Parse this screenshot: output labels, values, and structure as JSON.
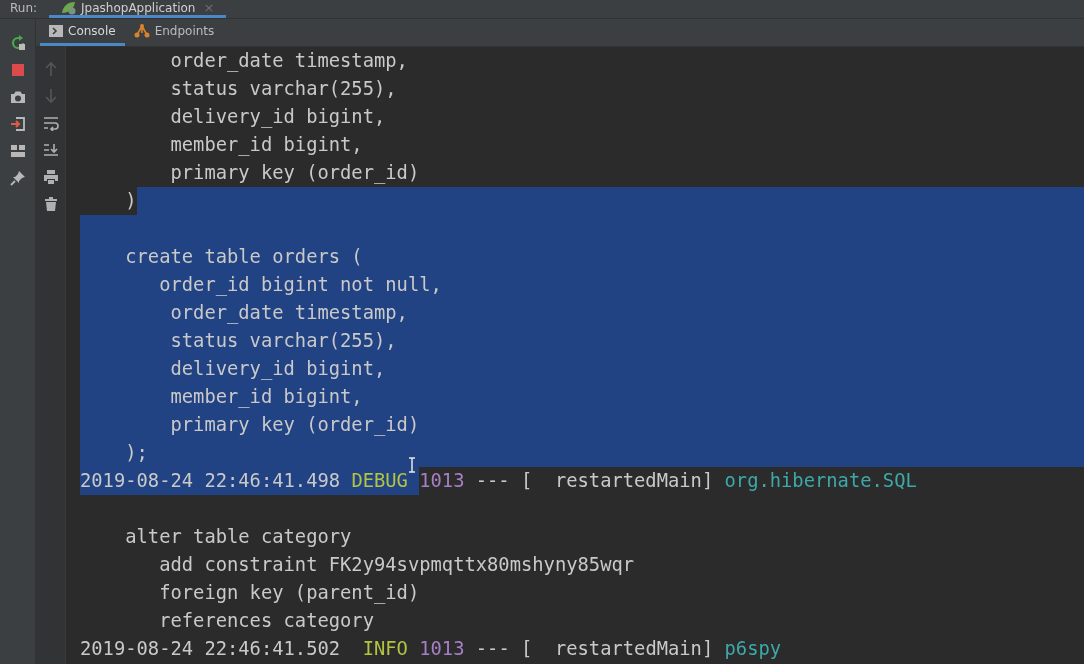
{
  "run_bar": {
    "label": "Run:",
    "tabs": [
      {
        "title": "JpashopApplication",
        "selected": true,
        "close": "×"
      }
    ]
  },
  "console_tabs": [
    {
      "label": "Console",
      "kind": "console",
      "selected": true
    },
    {
      "label": "Endpoints",
      "kind": "endpoints",
      "selected": false
    }
  ],
  "side_toolbar": [
    {
      "kind": "rerun"
    },
    {
      "kind": "stop"
    },
    {
      "kind": "camera"
    },
    {
      "kind": "exit"
    },
    {
      "kind": "layout"
    },
    {
      "kind": "pin"
    }
  ],
  "gutter_toolbar": [
    {
      "kind": "up",
      "disabled": true
    },
    {
      "kind": "down",
      "disabled": true
    },
    {
      "kind": "wrap",
      "disabled": false
    },
    {
      "kind": "scroll-end",
      "disabled": false
    },
    {
      "kind": "print",
      "disabled": false
    },
    {
      "kind": "trash",
      "disabled": false
    }
  ],
  "console_lines": [
    {
      "segments": [
        {
          "text": "        order_date timestamp,",
          "kind": "plain",
          "selected": false
        }
      ],
      "eol_selected": false
    },
    {
      "segments": [
        {
          "text": "        status varchar(255),",
          "kind": "plain",
          "selected": false
        }
      ],
      "eol_selected": false
    },
    {
      "segments": [
        {
          "text": "        delivery_id bigint,",
          "kind": "plain",
          "selected": false
        }
      ],
      "eol_selected": false
    },
    {
      "segments": [
        {
          "text": "        member_id bigint,",
          "kind": "plain",
          "selected": false
        }
      ],
      "eol_selected": false
    },
    {
      "segments": [
        {
          "text": "        primary key (order_id)",
          "kind": "plain",
          "selected": false
        }
      ],
      "eol_selected": false
    },
    {
      "segments": [
        {
          "text": "    )",
          "kind": "plain",
          "selected": false
        }
      ],
      "eol_selected": true
    },
    {
      "eol_selected": true
    },
    {
      "segments": [
        {
          "text": "    create table orders (",
          "kind": "plain",
          "selected": true
        }
      ],
      "eol_selected": true
    },
    {
      "segments": [
        {
          "text": "       order_id bigint not null,",
          "kind": "plain",
          "selected": true
        }
      ],
      "eol_selected": true
    },
    {
      "segments": [
        {
          "text": "        order_date timestamp,",
          "kind": "plain",
          "selected": true
        }
      ],
      "eol_selected": true
    },
    {
      "segments": [
        {
          "text": "        status varchar(255),",
          "kind": "plain",
          "selected": true
        }
      ],
      "eol_selected": true
    },
    {
      "segments": [
        {
          "text": "        delivery_id bigint,",
          "kind": "plain",
          "selected": true
        }
      ],
      "eol_selected": true
    },
    {
      "segments": [
        {
          "text": "        member_id bigint,",
          "kind": "plain",
          "selected": true
        }
      ],
      "eol_selected": true
    },
    {
      "segments": [
        {
          "text": "        primary key (order_id)",
          "kind": "plain",
          "selected": true
        }
      ],
      "eol_selected": true
    },
    {
      "segments": [
        {
          "text": "    );",
          "kind": "plain",
          "selected": true
        }
      ],
      "eol_selected": true
    },
    {
      "segments": [
        {
          "text": "2019-08-24 22:46:41.498 ",
          "kind": "plain",
          "selected": true
        },
        {
          "text": "DEBUG ",
          "kind": "level",
          "selected": true
        },
        {
          "text": "1013",
          "kind": "pid",
          "selected": false
        },
        {
          "text": " --- [  restartedMain] ",
          "kind": "plain",
          "selected": false
        },
        {
          "text": "org.hibernate.SQL",
          "kind": "logger",
          "selected": false
        }
      ],
      "eol_selected": false
    },
    {
      "eol_selected": false
    },
    {
      "segments": [
        {
          "text": "    alter table category",
          "kind": "plain",
          "selected": false
        }
      ],
      "eol_selected": false
    },
    {
      "segments": [
        {
          "text": "       add constraint FK2y94svpmqttx80mshyny85wqr",
          "kind": "plain",
          "selected": false
        }
      ],
      "eol_selected": false
    },
    {
      "segments": [
        {
          "text": "       foreign key (parent_id)",
          "kind": "plain",
          "selected": false
        }
      ],
      "eol_selected": false
    },
    {
      "segments": [
        {
          "text": "       references category",
          "kind": "plain",
          "selected": false
        }
      ],
      "eol_selected": false
    },
    {
      "segments": [
        {
          "text": "2019-08-24 22:46:41.502  ",
          "kind": "plain",
          "selected": false
        },
        {
          "text": "INFO ",
          "kind": "level",
          "selected": false
        },
        {
          "text": "1013",
          "kind": "pid",
          "selected": false
        },
        {
          "text": " --- [  restartedMain] ",
          "kind": "plain",
          "selected": false
        },
        {
          "text": "p6spy",
          "kind": "logger",
          "selected": false
        }
      ],
      "eol_selected": false
    }
  ]
}
